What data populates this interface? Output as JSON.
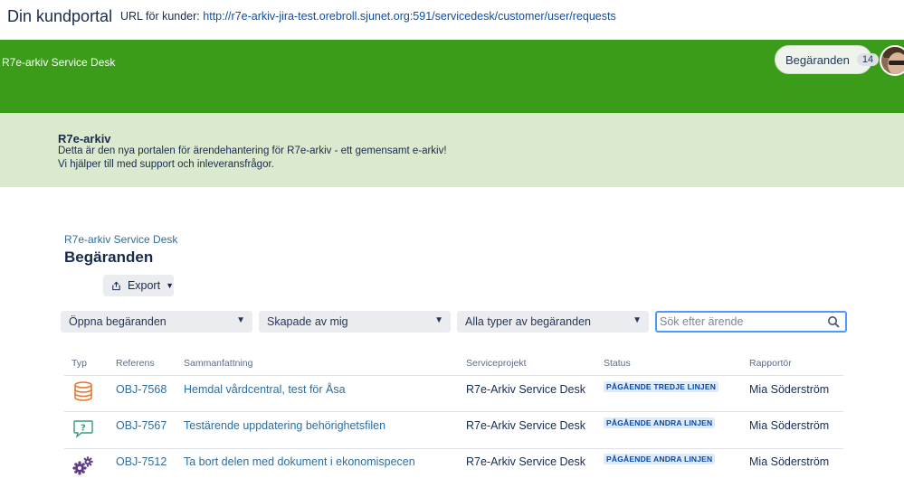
{
  "topbar": {
    "title": "Din kundportal",
    "url_label": "URL för kunder:",
    "url": "http://r7e-arkiv-jira-test.orebroll.sjunet.org:591/servicedesk/customer/user/requests"
  },
  "header": {
    "brand": "R7e-arkiv Service Desk",
    "requests_label": "Begäranden",
    "requests_count": "14",
    "color": "#3b9c1a"
  },
  "banner": {
    "title": "R7e-arkiv",
    "line1": "Detta är den nya portalen för ärendehantering för R7e-arkiv - ett gemensamt e-arkiv!",
    "line2": "Vi hjälper till med support och inleveransfrågor."
  },
  "breadcrumb": "R7e-arkiv Service Desk",
  "page_title": "Begäranden",
  "export_label": "Export",
  "filters": {
    "status": "Öppna begäranden",
    "created_by": "Skapade av mig",
    "type": "Alla typer av begäranden",
    "search_placeholder": "Sök efter ärende"
  },
  "table": {
    "headers": [
      "Typ",
      "Referens",
      "Sammanfattning",
      "Serviceprojekt",
      "Status",
      "Rapportör"
    ],
    "rows": [
      {
        "icon": "database-icon",
        "ref": "OBJ-7568",
        "summary": "Hemdal vårdcentral, test för Åsa",
        "project": "R7e-Arkiv Service Desk",
        "status": "PÅGÅENDE TREDJE LINJEN",
        "reporter": "Mia Söderström"
      },
      {
        "icon": "question-chat-icon",
        "ref": "OBJ-7567",
        "summary": "Testärende uppdatering behörighetsfilen",
        "project": "R7e-Arkiv Service Desk",
        "status": "PÅGÅENDE ANDRA LINJEN",
        "reporter": "Mia Söderström"
      },
      {
        "icon": "gears-icon",
        "ref": "OBJ-7512",
        "summary": "Ta bort delen med dokument i ekonomispecen",
        "project": "R7e-Arkiv Service Desk",
        "status": "PÅGÅENDE ANDRA LINJEN",
        "reporter": "Mia Söderström"
      }
    ]
  }
}
